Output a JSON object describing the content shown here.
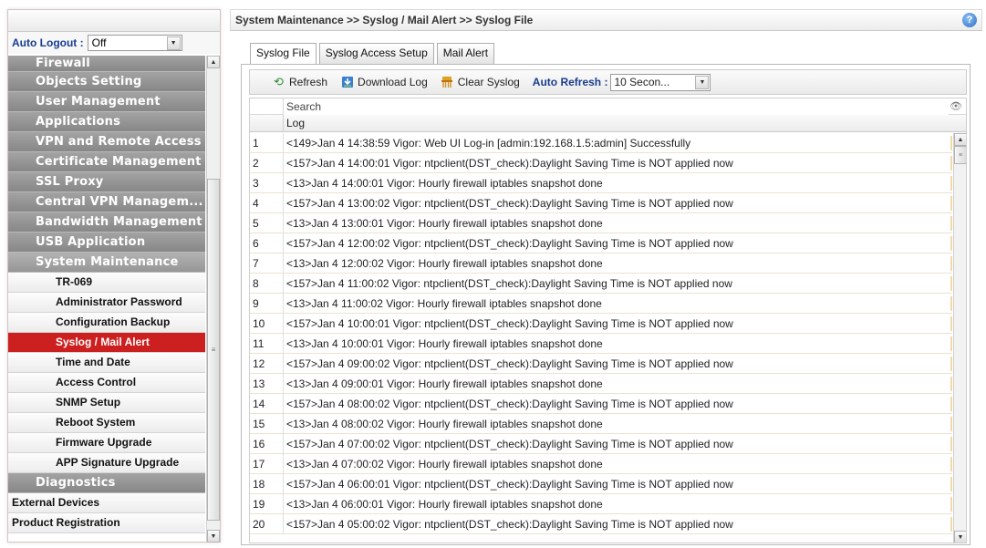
{
  "sidebar": {
    "auto_logout_label": "Auto Logout :",
    "auto_logout_value": "Off",
    "categories_top": [
      "Firewall",
      "Objects Setting",
      "User Management",
      "Applications",
      "VPN and Remote Access",
      "Certificate Management",
      "SSL Proxy",
      "Central VPN Managem...",
      "Bandwidth Management",
      "USB Application",
      "System Maintenance"
    ],
    "system_maintenance_items": [
      "TR-069",
      "Administrator Password",
      "Configuration Backup",
      "Syslog / Mail Alert",
      "Time and Date",
      "Access Control",
      "SNMP Setup",
      "Reboot System",
      "Firmware Upgrade",
      "APP Signature Upgrade"
    ],
    "selected_item": "Syslog / Mail Alert",
    "diagnostics": "Diagnostics",
    "external_devices": "External Devices",
    "product_registration": "Product Registration"
  },
  "header": {
    "breadcrumb": "System Maintenance >> Syslog / Mail Alert >> Syslog File",
    "help": "?"
  },
  "tabs": [
    "Syslog File",
    "Syslog Access Setup",
    "Mail Alert"
  ],
  "active_tab": "Syslog File",
  "toolbar": {
    "refresh": "Refresh",
    "download_log": "Download Log",
    "clear_syslog": "Clear Syslog",
    "auto_refresh_label": "Auto Refresh :",
    "auto_refresh_value": "10 Secon..."
  },
  "grid": {
    "search_placeholder": "Search",
    "column_log": "Log",
    "rows": [
      {
        "n": "1",
        "log": "<149>Jan 4 14:38:59 Vigor: Web UI Log-in [admin:192.168.1.5:admin] Successfully"
      },
      {
        "n": "2",
        "log": "<157>Jan 4 14:00:01 Vigor: ntpclient(DST_check):Daylight Saving Time is NOT applied now"
      },
      {
        "n": "3",
        "log": "<13>Jan 4 14:00:01 Vigor: Hourly firewall iptables snapshot done"
      },
      {
        "n": "4",
        "log": "<157>Jan 4 13:00:02 Vigor: ntpclient(DST_check):Daylight Saving Time is NOT applied now"
      },
      {
        "n": "5",
        "log": "<13>Jan 4 13:00:01 Vigor: Hourly firewall iptables snapshot done"
      },
      {
        "n": "6",
        "log": "<157>Jan 4 12:00:02 Vigor: ntpclient(DST_check):Daylight Saving Time is NOT applied now"
      },
      {
        "n": "7",
        "log": "<13>Jan 4 12:00:02 Vigor: Hourly firewall iptables snapshot done"
      },
      {
        "n": "8",
        "log": "<157>Jan 4 11:00:02 Vigor: ntpclient(DST_check):Daylight Saving Time is NOT applied now"
      },
      {
        "n": "9",
        "log": "<13>Jan 4 11:00:02 Vigor: Hourly firewall iptables snapshot done"
      },
      {
        "n": "10",
        "log": "<157>Jan 4 10:00:01 Vigor: ntpclient(DST_check):Daylight Saving Time is NOT applied now"
      },
      {
        "n": "11",
        "log": "<13>Jan 4 10:00:01 Vigor: Hourly firewall iptables snapshot done"
      },
      {
        "n": "12",
        "log": "<157>Jan 4 09:00:02 Vigor: ntpclient(DST_check):Daylight Saving Time is NOT applied now"
      },
      {
        "n": "13",
        "log": "<13>Jan 4 09:00:01 Vigor: Hourly firewall iptables snapshot done"
      },
      {
        "n": "14",
        "log": "<157>Jan 4 08:00:02 Vigor: ntpclient(DST_check):Daylight Saving Time is NOT applied now"
      },
      {
        "n": "15",
        "log": "<13>Jan 4 08:00:02 Vigor: Hourly firewall iptables snapshot done"
      },
      {
        "n": "16",
        "log": "<157>Jan 4 07:00:02 Vigor: ntpclient(DST_check):Daylight Saving Time is NOT applied now"
      },
      {
        "n": "17",
        "log": "<13>Jan 4 07:00:02 Vigor: Hourly firewall iptables snapshot done"
      },
      {
        "n": "18",
        "log": "<157>Jan 4 06:00:01 Vigor: ntpclient(DST_check):Daylight Saving Time is NOT applied now"
      },
      {
        "n": "19",
        "log": "<13>Jan 4 06:00:01 Vigor: Hourly firewall iptables snapshot done"
      },
      {
        "n": "20",
        "log": "<157>Jan 4 05:00:02 Vigor: ntpclient(DST_check):Daylight Saving Time is NOT applied now"
      }
    ]
  },
  "colors": {
    "selected_item_bg": "#cc2020",
    "category_bg": "#8f8f8f",
    "label_blue": "#1a3d8f"
  },
  "icons": {
    "refresh": "refresh-icon",
    "download": "download-icon",
    "clear": "clear-icon",
    "help": "help-icon",
    "columns": "eye-icon"
  }
}
